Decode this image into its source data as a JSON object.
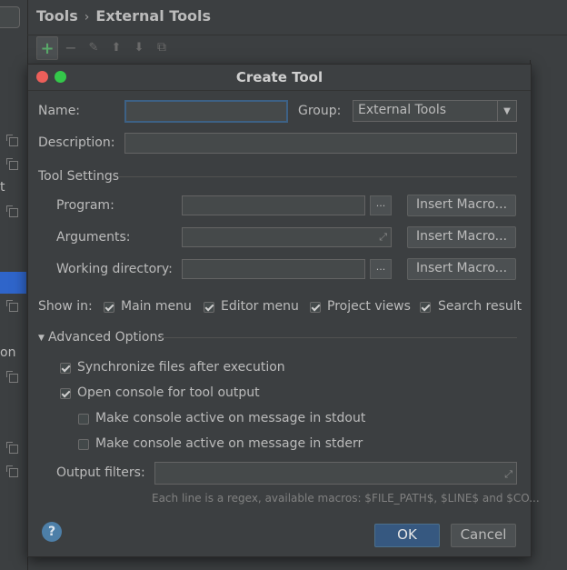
{
  "breadcrumb": {
    "parent": "Tools",
    "separator": "›",
    "current": "External Tools"
  },
  "left_fragments": {
    "frag1": "t",
    "frag2": "on"
  },
  "toolbar": {
    "add": "+",
    "remove": "−",
    "edit": "✎",
    "up": "⬆",
    "down": "⬇",
    "copy": "⧉"
  },
  "dialog": {
    "title": "Create Tool",
    "name_label": "Name:",
    "name_value": "",
    "group_label": "Group:",
    "group_value": "External Tools",
    "description_label": "Description:",
    "description_value": "",
    "tool_settings_title": "Tool Settings",
    "program_label": "Program:",
    "arguments_label": "Arguments:",
    "working_dir_label": "Working directory:",
    "browse_label": "...",
    "insert_macro_label": "Insert Macro...",
    "show_in_label": "Show in:",
    "show_in": [
      {
        "label": "Main menu",
        "checked": true
      },
      {
        "label": "Editor menu",
        "checked": true
      },
      {
        "label": "Project views",
        "checked": true
      },
      {
        "label": "Search result",
        "checked": true
      }
    ],
    "advanced_title": "Advanced Options",
    "advanced": [
      {
        "label": "Synchronize files after execution",
        "checked": true
      },
      {
        "label": "Open console for tool output",
        "checked": true
      },
      {
        "label": "Make console active on message in stdout",
        "checked": false
      },
      {
        "label": "Make console active on message in stderr",
        "checked": false
      }
    ],
    "output_filters_label": "Output filters:",
    "output_filters_hint": "Each line is a regex, available macros: $FILE_PATH$, $LINE$ and $CO...",
    "help_label": "?",
    "ok_label": "OK",
    "cancel_label": "Cancel"
  },
  "colors": {
    "background": "#3c3f41",
    "field": "#45494a",
    "focus_border": "#3d6185",
    "primary_button": "#365880",
    "selection": "#2f65ca",
    "close_dot": "#ec5f5a",
    "zoom_dot": "#34c84a",
    "add_icon": "#59a869"
  }
}
